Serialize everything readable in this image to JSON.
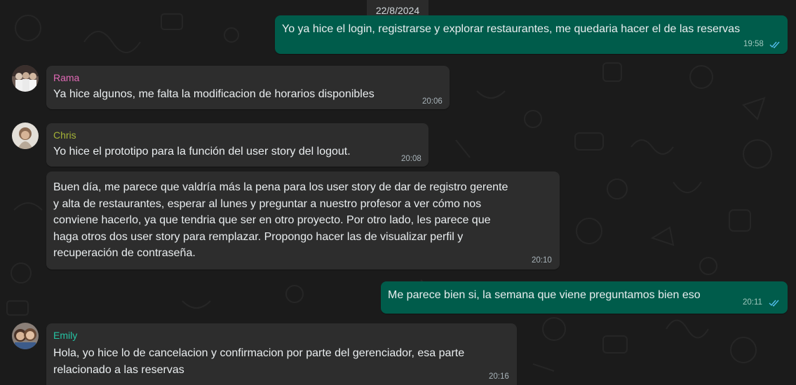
{
  "date_chip": "22/8/2024",
  "colors": {
    "incoming": "#2d2d2d",
    "outgoing": "#005c4b",
    "name_rama": "#e26ab6",
    "name_chris": "#a5b337",
    "name_emily": "#25c4a3",
    "read_ticks": "#53bdeb"
  },
  "messages": [
    {
      "direction": "outgoing",
      "lines": [
        "Yo ya hice el login, registrarse y explorar restaurantes, me quedaria hacer el de las reservas"
      ],
      "time": "19:58",
      "status_icon": "double-check-read-icon"
    },
    {
      "direction": "incoming",
      "sender": "Rama",
      "lines": [
        "Ya hice algunos, me falta la modificacion de horarios disponibles"
      ],
      "time": "20:06"
    },
    {
      "direction": "incoming",
      "sender": "Chris",
      "lines": [
        "Yo hice el prototipo para la función del user story del logout."
      ],
      "time": "20:08"
    },
    {
      "direction": "incoming",
      "lines": [
        "Buen día, me parece que valdría más la pena para los user story de dar de registro gerente",
        "y alta de restaurantes, esperar al lunes y preguntar a nuestro profesor a ver cómo nos",
        "conviene hacerlo, ya que tendria que ser en otro proyecto. Por otro lado, les parece que",
        "haga otros dos user story para remplazar. Propongo hacer las de visualizar perfil y",
        "recuperación de contraseña."
      ],
      "time": "20:10"
    },
    {
      "direction": "outgoing",
      "lines": [
        "Me parece bien si, la semana que viene preguntamos bien eso"
      ],
      "time": "20:11",
      "status_icon": "double-check-read-icon"
    },
    {
      "direction": "incoming",
      "sender": "Emily",
      "lines": [
        "Hola, yo hice lo de cancelacion y confirmacion por parte del gerenciador, esa parte",
        "relacionado a las reservas"
      ],
      "time": "20:16"
    }
  ]
}
